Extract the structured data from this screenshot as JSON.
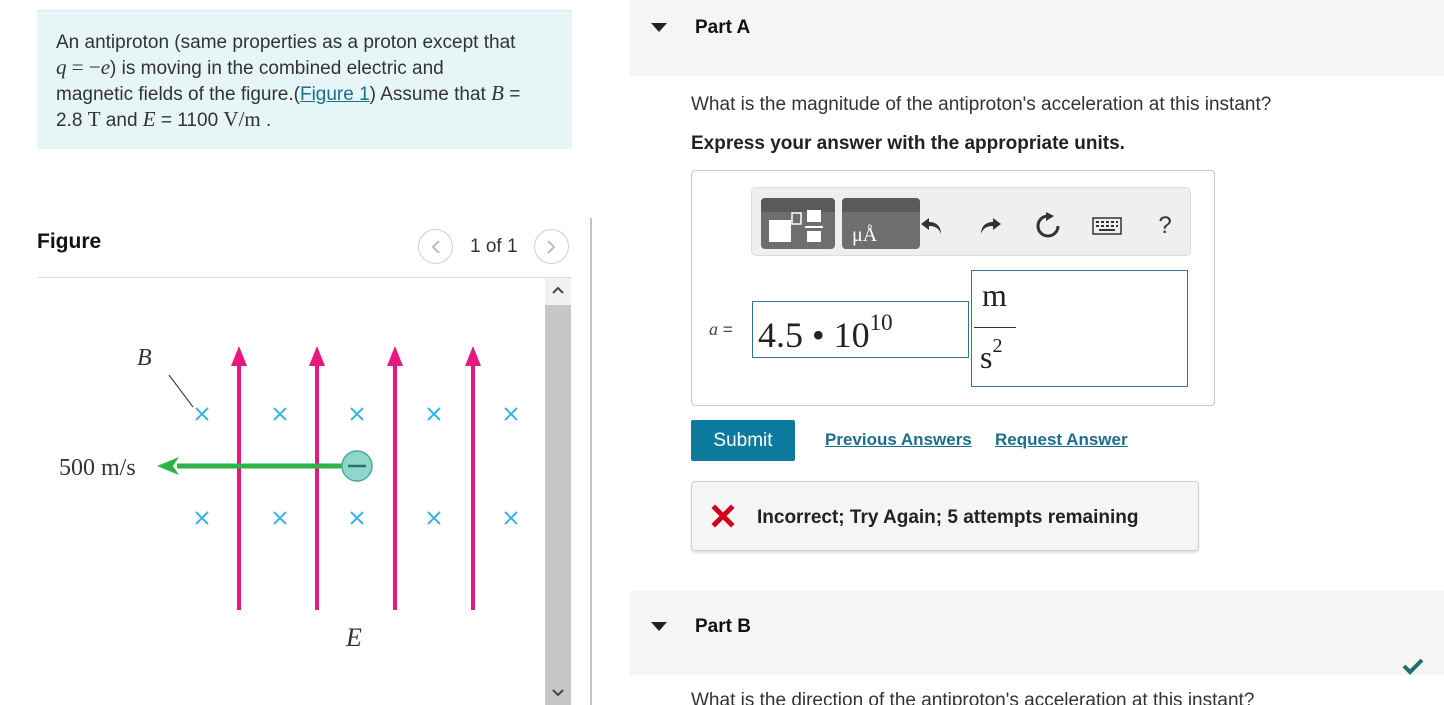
{
  "problem": {
    "text_1": "An antiproton (same properties as a proton except that",
    "q_var": "q",
    "q_eq": " = −",
    "e_var": "e",
    "text_2": ") is moving in the combined electric and",
    "text_3": "magnetic fields of the figure.(",
    "figure_link": "Figure 1",
    "text_4": ") Assume that ",
    "b_var": "B",
    "text_5": " =",
    "b_value": "2.8",
    "b_unit": "T",
    "text_6": " and ",
    "e_field_var": "E",
    "text_7": " = 1100 ",
    "e_unit": "V/m",
    "text_8": " ."
  },
  "figure": {
    "title": "Figure",
    "counter": "1 of 1",
    "b_label": "B",
    "e_label": "E",
    "speed_label": "500 m/s",
    "cross_glyph": "×",
    "particle_sign": "−",
    "colors": {
      "field_lines": "#e5197f",
      "velocity_arrow": "#2db34a",
      "cross_marks": "#35b6e5",
      "particle": "#8fd6cd"
    }
  },
  "part_a": {
    "label": "Part A",
    "question": "What is the magnitude of the antiproton's acceleration at this instant?",
    "instruction": "Express your answer with the appropriate units.",
    "toolbar": {
      "units_button_label": "μÅ",
      "help_label": "?",
      "icons": [
        "template-icon",
        "units-icon",
        "undo-icon",
        "redo-icon",
        "reset-icon",
        "keyboard-icon",
        "help-icon"
      ]
    },
    "answer": {
      "variable": "a",
      "equals": " =",
      "value_mantissa": "4.5 • 10",
      "value_exponent": "10",
      "unit_numerator": "m",
      "unit_denominator": "s",
      "unit_denominator_exponent": "2"
    },
    "submit_label": "Submit",
    "previous_answers_label": "Previous Answers",
    "request_answer_label": "Request Answer",
    "feedback": "Incorrect; Try Again; 5 attempts remaining",
    "feedback_color": "#d0021b"
  },
  "part_b": {
    "label": "Part B",
    "question": "What is the direction of the antiproton's acceleration at this instant?"
  },
  "colors": {
    "accent": "#0c7a9f",
    "link": "#1b6f8a",
    "problem_bg": "#e6f5f5",
    "complete_check": "#1f6f6f"
  }
}
